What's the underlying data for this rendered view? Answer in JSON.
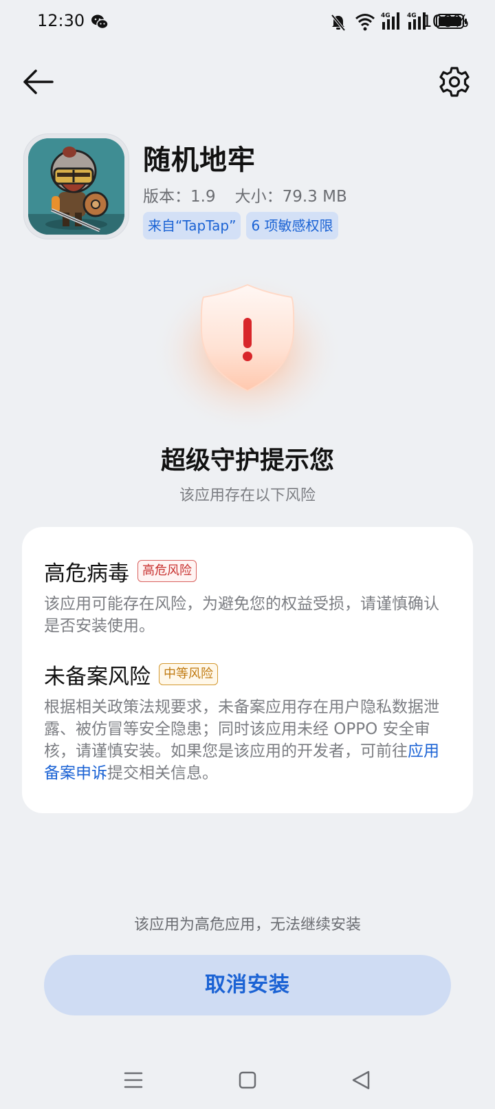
{
  "status_bar": {
    "time": "12:30",
    "battery": "100%",
    "icons": [
      "wechat-icon",
      "mute-bell-icon",
      "wifi-icon",
      "4g-signal-icon",
      "4g-signal-icon",
      "battery-icon"
    ]
  },
  "toolbar": {
    "back_icon": "back-arrow-icon",
    "settings_icon": "gear-icon"
  },
  "app": {
    "name": "随机地牢",
    "version_label": "版本：1.9",
    "size_label": "大小：79.3 MB",
    "tags": [
      "来自“TapTap”",
      "6 项敏感权限"
    ]
  },
  "warning": {
    "icon": "shield-warning-icon",
    "title": "超级守护提示您",
    "subtitle": "该应用存在以下风险"
  },
  "risks": [
    {
      "title": "高危病毒",
      "badge": "高危风险",
      "desc": "该应用可能存在风险，为避免您的权益受损，请谨慎确认是否安装使用。"
    },
    {
      "title": "未备案风险",
      "badge": "中等风险",
      "desc_prefix": "根据相关政策法规要求，未备案应用存在用户隐私数据泄露、被仿冒等安全隐患；同时该应用未经 OPPO 安全审核，请谨慎安装。如果您是该应用的开发者，可前往",
      "link": "应用备案申诉",
      "desc_suffix": "提交相关信息。"
    }
  ],
  "footer": {
    "note": "该应用为高危应用，无法继续安装",
    "cancel_button": "取消安装"
  },
  "nav": [
    "menu-icon",
    "home-icon",
    "back-triangle-icon"
  ],
  "colors": {
    "accent": "#1a62d4",
    "background": "#eef0f3",
    "high_risk": "#c8312f",
    "mid_risk": "#c07a10"
  }
}
